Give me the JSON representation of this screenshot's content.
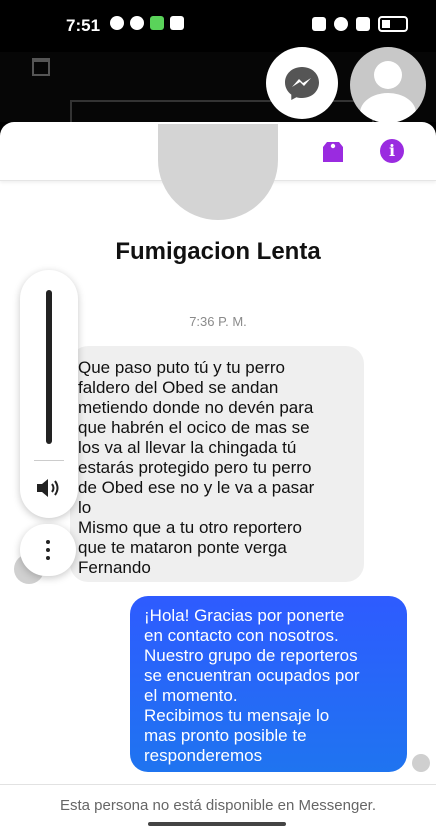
{
  "status_bar": {
    "time": "7:51"
  },
  "chat": {
    "contact_name": "Fumigacion Lenta",
    "timestamp": "7:36 P. M.",
    "incoming_message": "Que paso puto tú y tu perro\nfaldero del Obed se andan\nmetiendo donde no devén para\nque habrén el ocico de mas se\nlos va al llevar la chingada tú\nestarás protegido pero tu perro\nde Obed ese no y le va a pasar\nlo\nMismo que a tu otro reportero\nque te mataron ponte verga\nFernando",
    "outgoing_message": "¡Hola! Gracias por ponerte\nen contacto con nosotros.\nNuestro grupo de reporteros\nse encuentran ocupados por\nel momento.\nRecibimos tu mensaje lo\nmas pronto posible te\nresponderemos",
    "footer_notice": "Esta persona no está disponible en Messenger."
  },
  "colors": {
    "accent_purple": "#9a2be0",
    "outgoing_bubble": "#1f74f0",
    "incoming_bubble": "#efefef"
  },
  "icons": {
    "messenger": "messenger-icon",
    "tag": "tag-icon",
    "info": "info-icon",
    "volume": "volume-icon",
    "more": "more-vertical-icon",
    "trash": "trash-icon"
  }
}
